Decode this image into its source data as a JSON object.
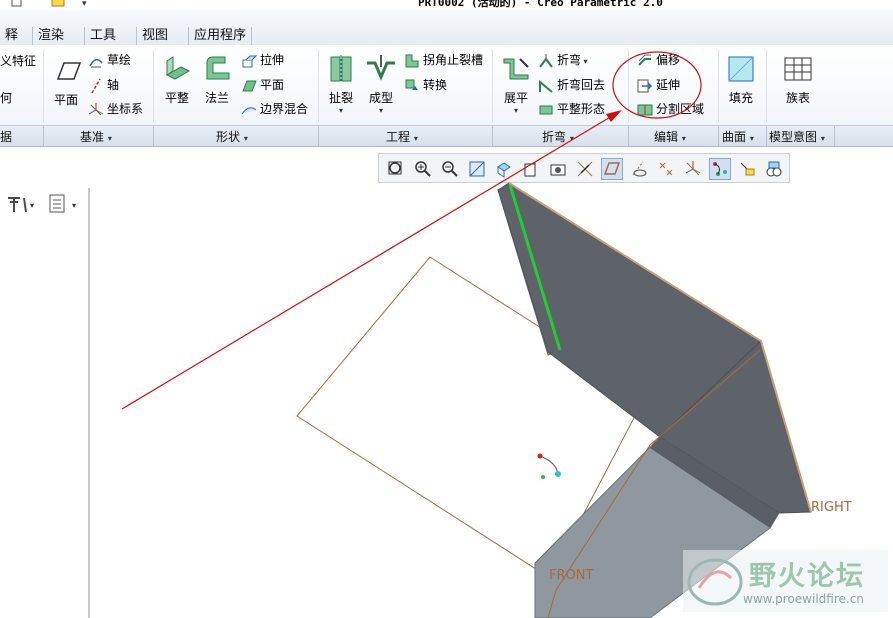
{
  "window": {
    "title": "PRT0002 (活动的) - Creo Parametric 2.0"
  },
  "tabs": [
    "释",
    "渲染",
    "工具",
    "视图",
    "应用程序"
  ],
  "ribbon": {
    "partial_left": [
      "义特征",
      "何"
    ],
    "datum": {
      "plane": "平面",
      "sketch": "草绘",
      "axis": "轴",
      "csys": "坐标系"
    },
    "shapes": {
      "flat": "平整",
      "flange": "法兰",
      "extrude": "拉伸",
      "planar": "平面",
      "boundary_blend": "边界混合"
    },
    "engineering": {
      "rip": "扯裂",
      "form": "成型",
      "corner_relief": "拐角止裂槽",
      "convert": "转换"
    },
    "bend": {
      "unbend": "展平",
      "bend": "折弯",
      "bend_back": "折弯回去",
      "flat_pattern": "平整形态"
    },
    "editing": {
      "offset": "偏移",
      "extend": "延伸",
      "split_area": "分割区域"
    },
    "surfaces": {
      "fill": "填充"
    },
    "model_intent": {
      "family_table": "族表"
    }
  },
  "groups": [
    "据",
    "基准",
    "形状",
    "工程",
    "折弯",
    "编辑",
    "曲面",
    "模型意图"
  ],
  "viewport": {
    "datum_right": "RIGHT",
    "datum_front": "FRONT"
  },
  "watermark": {
    "cn": "野火论坛",
    "url": "www.proewildfire.cn"
  },
  "colors": {
    "annotation_red": "#cc1111",
    "model_dark": "#5e6369",
    "model_light": "#8f989f",
    "datum_brown": "#a8693c",
    "highlight_green": "#22cc33"
  }
}
